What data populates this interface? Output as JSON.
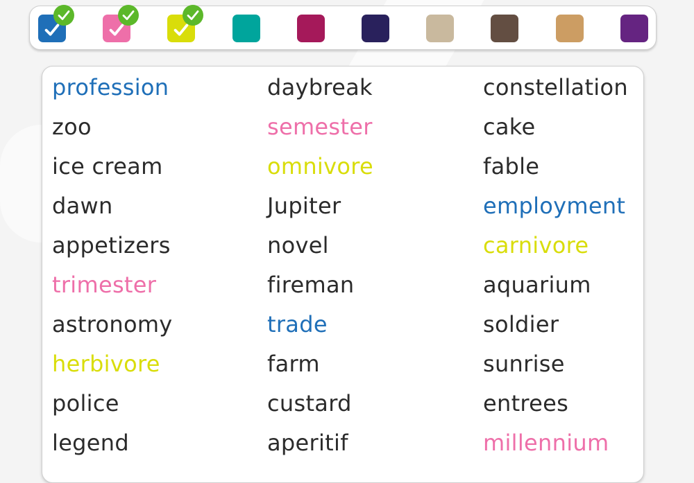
{
  "palette": {
    "swatches": [
      {
        "name": "blue",
        "color": "#1f6fb8",
        "selected": true
      },
      {
        "name": "pink",
        "color": "#ee6fa9",
        "selected": true
      },
      {
        "name": "yellow",
        "color": "#d9dd0a",
        "selected": true
      },
      {
        "name": "teal",
        "color": "#00a59c",
        "selected": false
      },
      {
        "name": "crimson",
        "color": "#a5195a",
        "selected": false
      },
      {
        "name": "navy",
        "color": "#29215c",
        "selected": false
      },
      {
        "name": "beige",
        "color": "#c9b99e",
        "selected": false
      },
      {
        "name": "brown",
        "color": "#634e42",
        "selected": false
      },
      {
        "name": "tan",
        "color": "#cc9d63",
        "selected": false
      },
      {
        "name": "purple",
        "color": "#652481",
        "selected": false
      }
    ],
    "badge_color": "#5cb82a"
  },
  "colors": {
    "default_text": "#2b2b2b",
    "blue": "#1f6fb8",
    "pink": "#ee6fa9",
    "yellow": "#d9dd0a"
  },
  "words": [
    [
      {
        "text": "profession",
        "color": "blue"
      },
      {
        "text": "zoo",
        "color": "default_text"
      },
      {
        "text": "ice cream",
        "color": "default_text"
      },
      {
        "text": "dawn",
        "color": "default_text"
      },
      {
        "text": "appetizers",
        "color": "default_text"
      },
      {
        "text": "trimester",
        "color": "pink"
      },
      {
        "text": "astronomy",
        "color": "default_text"
      },
      {
        "text": "herbivore",
        "color": "yellow"
      },
      {
        "text": "police",
        "color": "default_text"
      },
      {
        "text": "legend",
        "color": "default_text"
      }
    ],
    [
      {
        "text": "daybreak",
        "color": "default_text"
      },
      {
        "text": "semester",
        "color": "pink"
      },
      {
        "text": "omnivore",
        "color": "yellow"
      },
      {
        "text": "Jupiter",
        "color": "default_text"
      },
      {
        "text": "novel",
        "color": "default_text"
      },
      {
        "text": "fireman",
        "color": "default_text"
      },
      {
        "text": "trade",
        "color": "blue"
      },
      {
        "text": "farm",
        "color": "default_text"
      },
      {
        "text": "custard",
        "color": "default_text"
      },
      {
        "text": "aperitif",
        "color": "default_text"
      }
    ],
    [
      {
        "text": "constellation",
        "color": "default_text"
      },
      {
        "text": "cake",
        "color": "default_text"
      },
      {
        "text": "fable",
        "color": "default_text"
      },
      {
        "text": "employment",
        "color": "blue"
      },
      {
        "text": "carnivore",
        "color": "yellow"
      },
      {
        "text": "aquarium",
        "color": "default_text"
      },
      {
        "text": "soldier",
        "color": "default_text"
      },
      {
        "text": "sunrise",
        "color": "default_text"
      },
      {
        "text": "entrees",
        "color": "default_text"
      },
      {
        "text": "millennium",
        "color": "pink"
      }
    ]
  ]
}
